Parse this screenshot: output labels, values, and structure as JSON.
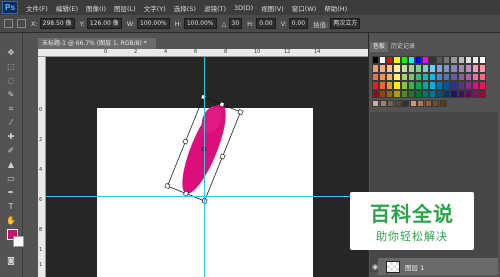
{
  "app": {
    "logo": "Ps"
  },
  "menu": [
    "文件(F)",
    "编辑(E)",
    "图像(I)",
    "图层(L)",
    "文字(Y)",
    "选择(S)",
    "滤镜(T)",
    "3D(D)",
    "视图(V)",
    "窗口(W)",
    "帮助(H)"
  ],
  "options": {
    "x_label": "X:",
    "x_value": "298.50 像",
    "y_label": "Y:",
    "y_value": "126.00 像",
    "w_label": "W:",
    "w_value": "100.00%",
    "h_label": "H:",
    "h_value": "100.00%",
    "angle_value": "30",
    "hskew_label": "H:",
    "hskew_value": "0.00",
    "vskew_label": "V:",
    "vskew_value": "0.00",
    "interp_label": "插值:",
    "interp_value": "两次立方"
  },
  "document": {
    "tab_title": "未标题-1 @ 66.7% (图层 1, RGB/8) *"
  },
  "ruler": {
    "top_ticks": [
      "0",
      "2",
      "4",
      "6",
      "8",
      "10",
      "12",
      "14"
    ],
    "left_ticks": [
      "0",
      "2",
      "4",
      "6",
      "8",
      "1",
      "1"
    ]
  },
  "panels": {
    "tab_color": "色板",
    "tab_history": "历史记录"
  },
  "layers": {
    "layer_name": "图层 1"
  },
  "colors": {
    "foreground": "#c8106e",
    "background": "#ffffff",
    "shape": "#dc0f7a",
    "guide": "#35c8e8"
  },
  "watermark": {
    "main": "百科全说",
    "sub": "助你轻松解决"
  }
}
